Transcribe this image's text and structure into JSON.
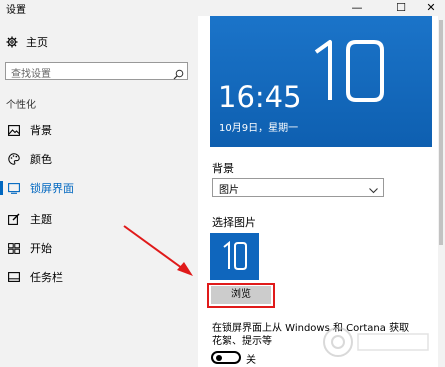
{
  "window": {
    "title": "设置",
    "min_glyph": "—",
    "max_glyph": "☐",
    "close_glyph": "✕"
  },
  "sidebar": {
    "home": {
      "label": "主页",
      "icon": "gear-icon"
    },
    "search": {
      "placeholder": "查找设置",
      "icon": "search-icon"
    },
    "section_title": "个性化",
    "items": [
      {
        "label": "背景",
        "icon": "image-icon",
        "active": false
      },
      {
        "label": "颜色",
        "icon": "palette-icon",
        "active": false
      },
      {
        "label": "锁屏界面",
        "icon": "lock-screen-icon",
        "active": true
      },
      {
        "label": "主题",
        "icon": "theme-icon",
        "active": false
      },
      {
        "label": "开始",
        "icon": "start-grid-icon",
        "active": false
      },
      {
        "label": "任务栏",
        "icon": "taskbar-icon",
        "active": false
      }
    ]
  },
  "preview": {
    "time": "16:45",
    "date": "10月9日，星期一",
    "logo": "10"
  },
  "background": {
    "label": "背景",
    "selected": "图片",
    "choose_label": "选择图片",
    "thumb_logo": "10",
    "browse_label": "浏览"
  },
  "info": {
    "text": "在锁屏界面上从 Windows 和 Cortana 获取花絮、提示等",
    "toggle_label": "关",
    "toggle_on": false
  },
  "colors": {
    "accent": "#0067c0",
    "annotation": "#e01a1a",
    "preview_bg": "#1467c0"
  }
}
